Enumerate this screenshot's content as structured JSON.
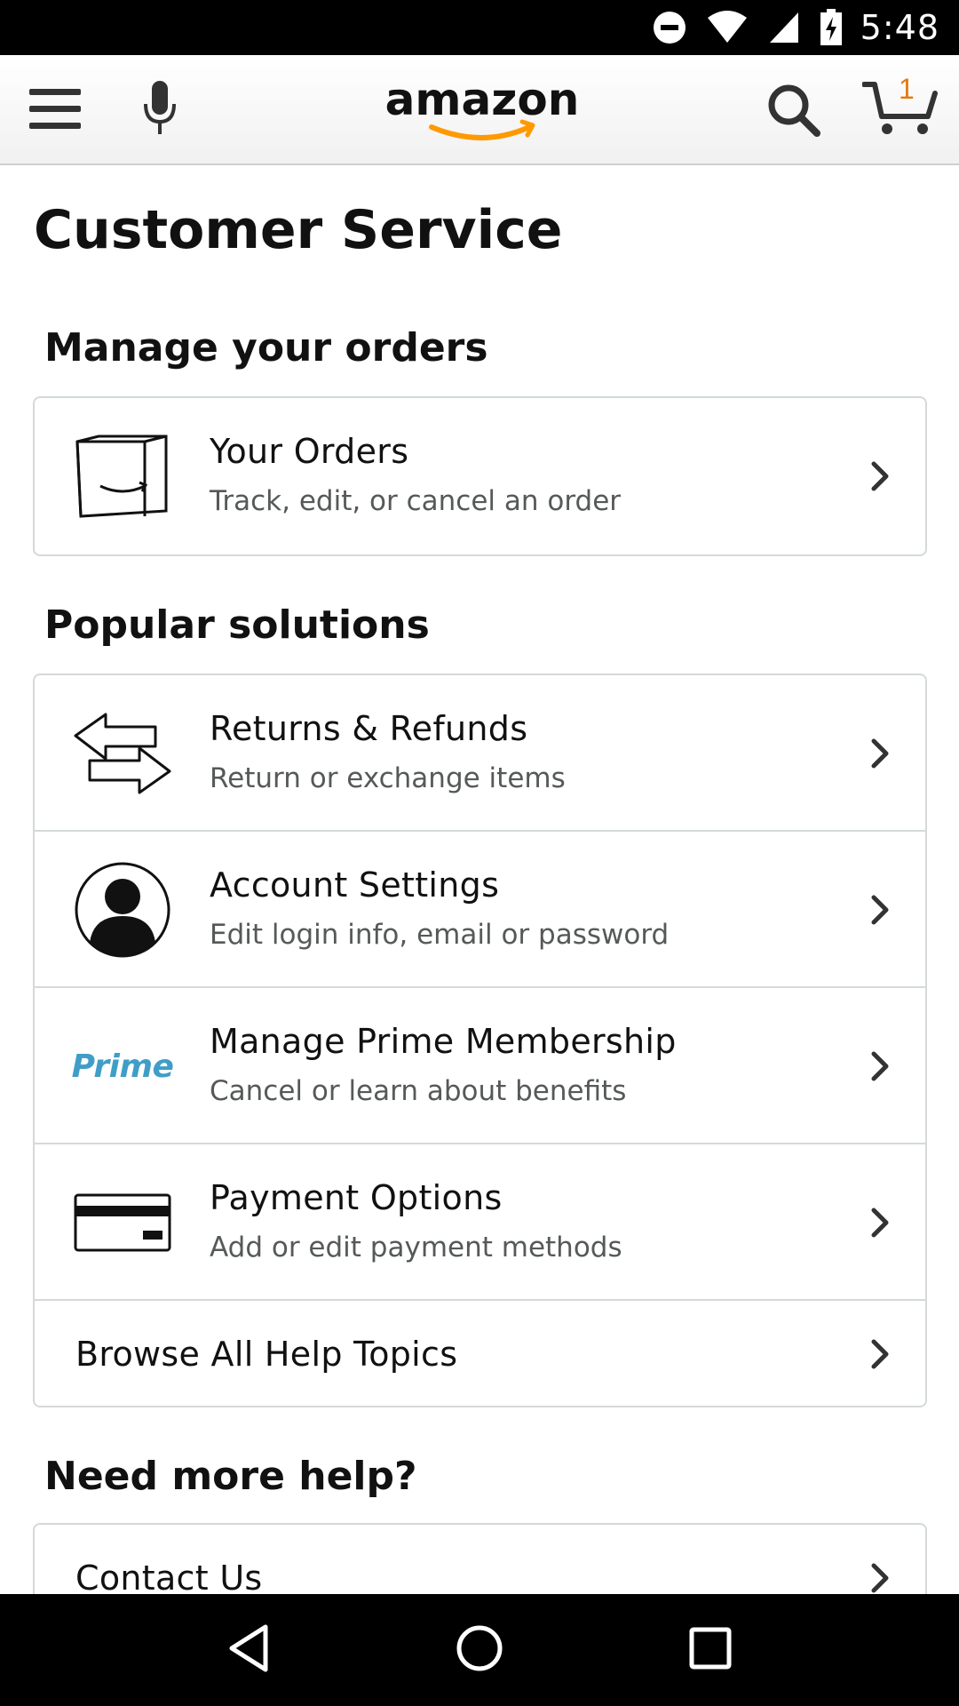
{
  "status_bar": {
    "time": "5:48",
    "icons": [
      "do-not-disturb-icon",
      "wifi-icon",
      "cell-signal-icon",
      "battery-charging-icon"
    ]
  },
  "header": {
    "logo_text": "amazon",
    "cart_count": "1",
    "icons": [
      "menu-icon",
      "microphone-icon",
      "search-icon",
      "cart-icon"
    ],
    "accent_color": "#ff9900"
  },
  "page": {
    "title": "Customer Service"
  },
  "sections": {
    "orders": {
      "title": "Manage your orders",
      "items": [
        {
          "title": "Your Orders",
          "subtitle": "Track, edit, or cancel an order",
          "icon": "box-icon"
        }
      ]
    },
    "popular": {
      "title": "Popular solutions",
      "items": [
        {
          "title": "Returns & Refunds",
          "subtitle": "Return or exchange items",
          "icon": "returns-arrows-icon"
        },
        {
          "title": "Account Settings",
          "subtitle": "Edit login info, email or password",
          "icon": "account-person-icon"
        },
        {
          "title": "Manage Prime Membership",
          "subtitle": "Cancel or learn about benefits",
          "icon": "prime-logo-icon",
          "icon_text": "Prime"
        },
        {
          "title": "Payment Options",
          "subtitle": "Add or edit payment methods",
          "icon": "credit-card-icon"
        },
        {
          "title": "Browse All Help Topics"
        }
      ]
    },
    "more_help": {
      "title": "Need more help?",
      "items": [
        {
          "title": "Contact Us"
        }
      ]
    }
  },
  "nav_bar": {
    "icons": [
      "back-icon",
      "home-icon",
      "recents-icon"
    ]
  }
}
